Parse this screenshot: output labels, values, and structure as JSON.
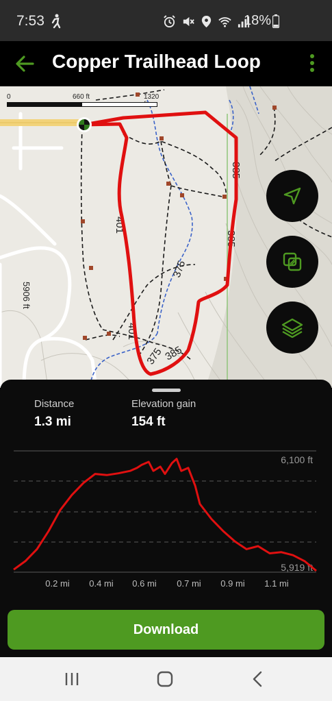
{
  "status_bar": {
    "time": "7:53",
    "battery": "18%",
    "icons": [
      "person-walk-icon",
      "alarm-icon",
      "mute-icon",
      "location-icon",
      "wifi-icon",
      "signal-icon",
      "battery-icon"
    ]
  },
  "app_bar": {
    "title": "Copper Trailhead Loop",
    "back_icon": "arrow-left-icon",
    "menu_icon": "more-vertical-icon"
  },
  "map": {
    "scale_labels": [
      "0",
      "660 ft",
      "1320 ft"
    ],
    "contour_labels": [
      "5906 ft",
      "375",
      "375",
      "385",
      "385",
      "385",
      "401",
      "401"
    ],
    "fab_icons": [
      "navigation-arrow-icon",
      "overlay-icon",
      "layers-icon"
    ]
  },
  "stats": {
    "distance_label": "Distance",
    "distance_value": "1.3 mi",
    "elevation_label": "Elevation gain",
    "elevation_value": "154 ft"
  },
  "chart_data": {
    "type": "line",
    "y_max_label": "6,100 ft",
    "y_min_label": "5,919 ft",
    "x_tick_labels": [
      "0.2 mi",
      "0.4 mi",
      "0.6 mi",
      "0.7 mi",
      "0.9 mi",
      "1.1 mi"
    ],
    "ylim": [
      5919,
      6100
    ],
    "x": [
      0.0,
      0.05,
      0.1,
      0.15,
      0.2,
      0.25,
      0.3,
      0.35,
      0.4,
      0.45,
      0.5,
      0.53,
      0.55,
      0.58,
      0.6,
      0.63,
      0.65,
      0.68,
      0.7,
      0.72,
      0.75,
      0.78,
      0.8,
      0.85,
      0.9,
      0.95,
      1.0,
      1.05,
      1.1,
      1.15,
      1.2,
      1.25,
      1.3
    ],
    "y": [
      5921,
      5935,
      5955,
      5985,
      6020,
      6045,
      6065,
      6080,
      6078,
      6081,
      6085,
      6090,
      6095,
      6100,
      6085,
      6092,
      6080,
      6098,
      6105,
      6085,
      6090,
      6060,
      6030,
      6005,
      5985,
      5968,
      5955,
      5960,
      5948,
      5950,
      5945,
      5935,
      5919
    ],
    "line_color": "#e01010"
  },
  "download": {
    "label": "Download"
  },
  "nav_bar": {
    "icons": [
      "recents-icon",
      "home-icon",
      "back-icon"
    ]
  },
  "colors": {
    "accent": "#4e9a21",
    "route": "#e01010"
  }
}
